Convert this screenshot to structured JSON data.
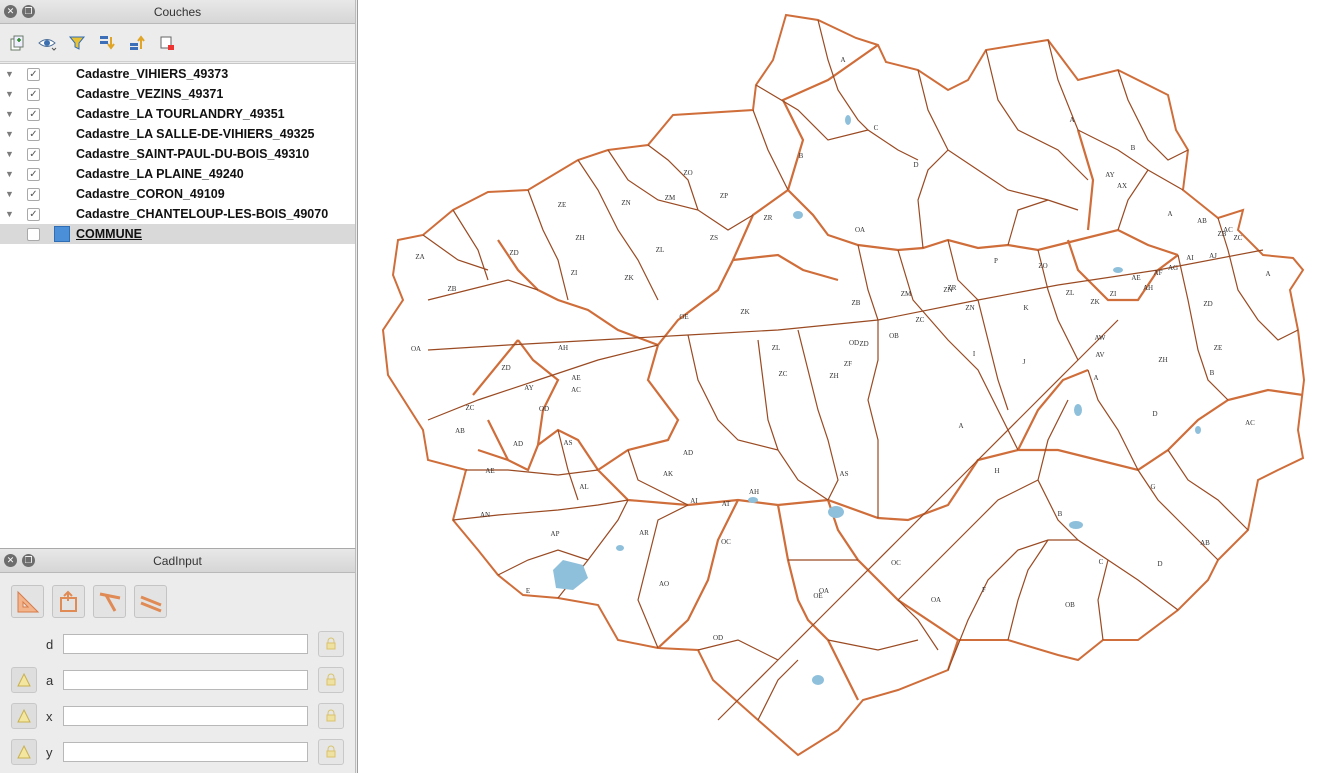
{
  "layers_panel": {
    "title": "Couches",
    "toolbar": [
      {
        "icon": "add-group-icon"
      },
      {
        "icon": "visibility-eye-icon"
      },
      {
        "icon": "filter-icon"
      },
      {
        "icon": "expand-all-icon"
      },
      {
        "icon": "collapse-all-icon"
      },
      {
        "icon": "remove-layer-icon"
      }
    ],
    "layers": [
      {
        "name": "Cadastre_VIHIERS_49373",
        "checked": true
      },
      {
        "name": "Cadastre_VEZINS_49371",
        "checked": true
      },
      {
        "name": "Cadastre_LA TOURLANDRY_49351",
        "checked": true
      },
      {
        "name": "Cadastre_LA SALLE-DE-VIHIERS_49325",
        "checked": true
      },
      {
        "name": "Cadastre_SAINT-PAUL-DU-BOIS_49310",
        "checked": true
      },
      {
        "name": "Cadastre_LA PLAINE_49240",
        "checked": true
      },
      {
        "name": "Cadastre_CORON_49109",
        "checked": true
      },
      {
        "name": "Cadastre_CHANTELOUP-LES-BOIS_49070",
        "checked": true
      },
      {
        "name": "COMMUNE",
        "checked": false,
        "selected": true,
        "symbol_color": "#4b8fd8"
      }
    ]
  },
  "cad_panel": {
    "title": "CadInput",
    "fields": {
      "d": {
        "label": "d",
        "value": ""
      },
      "a": {
        "label": "a",
        "value": ""
      },
      "x": {
        "label": "x",
        "value": ""
      },
      "y": {
        "label": "y",
        "value": ""
      }
    }
  },
  "map": {
    "colors": {
      "commune_border": "#cf6e3a",
      "parcel_border": "#9a4a22",
      "water": "#8fc0db"
    },
    "section_labels": [
      "A",
      "C",
      "B",
      "D",
      "A",
      "B",
      "AY",
      "AX",
      "A",
      "AB",
      "AC",
      "AE",
      "AF",
      "AG",
      "AH",
      "AI",
      "AJ",
      "ZB",
      "ZC",
      "A",
      "ZO",
      "ZN",
      "ZM",
      "ZP",
      "ZR",
      "ZE",
      "ZH",
      "ZD",
      "ZA",
      "ZB",
      "ZL",
      "ZS",
      "ZI",
      "ZK",
      "OA",
      "ZM",
      "ZN",
      "ZC",
      "ZR",
      "P",
      "ZO",
      "ZL",
      "ZK",
      "ZI",
      "ZD",
      "ZE",
      "ZH",
      "AW",
      "AV",
      "A",
      "B",
      "D",
      "K",
      "J",
      "I",
      "ZN",
      "ZB",
      "OB",
      "OE",
      "ZK",
      "ZL",
      "OD",
      "ZH",
      "ZF",
      "ZD",
      "ZC",
      "AE",
      "AH",
      "AS",
      "AC",
      "OA",
      "ZD",
      "AY",
      "AD",
      "OD",
      "ZC",
      "OA",
      "AB",
      "AD",
      "AE",
      "AK",
      "AL",
      "AI",
      "AN",
      "AP",
      "AR",
      "AH",
      "AT",
      "OC",
      "AS",
      "AO",
      "E",
      "B",
      "G",
      "H",
      "A",
      "AC",
      "AB",
      "C",
      "D",
      "F",
      "OB",
      "OC",
      "OA",
      "OE",
      "OD"
    ]
  }
}
